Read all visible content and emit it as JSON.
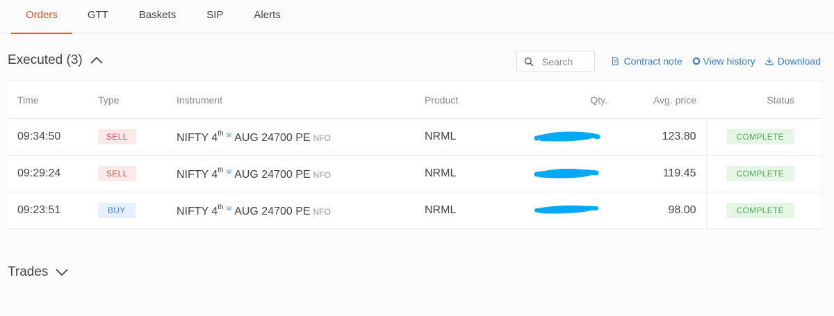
{
  "tabs": [
    {
      "label": "Orders",
      "active": true
    },
    {
      "label": "GTT",
      "active": false
    },
    {
      "label": "Baskets",
      "active": false
    },
    {
      "label": "SIP",
      "active": false
    },
    {
      "label": "Alerts",
      "active": false
    }
  ],
  "executed": {
    "title": "Executed (3)",
    "search_placeholder": "Search",
    "actions": {
      "contract_note": "Contract note",
      "view_history": "View history",
      "download": "Download"
    },
    "columns": {
      "time": "Time",
      "type": "Type",
      "instrument": "Instrument",
      "product": "Product",
      "qty": "Qty.",
      "avg_price": "Avg. price",
      "status": "Status"
    },
    "rows": [
      {
        "time": "09:34:50",
        "type": "SELL",
        "symbol": "NIFTY 4",
        "suffix": "th",
        "weekly": "W",
        "rest": "AUG 24700 PE",
        "exchange": "NFO",
        "product": "NRML",
        "avg_price": "123.80",
        "status": "COMPLETE"
      },
      {
        "time": "09:29:24",
        "type": "SELL",
        "symbol": "NIFTY 4",
        "suffix": "th",
        "weekly": "W",
        "rest": "AUG 24700 PE",
        "exchange": "NFO",
        "product": "NRML",
        "avg_price": "119.45",
        "status": "COMPLETE"
      },
      {
        "time": "09:23:51",
        "type": "BUY",
        "symbol": "NIFTY 4",
        "suffix": "th",
        "weekly": "W",
        "rest": "AUG 24700 PE",
        "exchange": "NFO",
        "product": "NRML",
        "avg_price": "98.00",
        "status": "COMPLETE"
      }
    ]
  },
  "trades": {
    "title": "Trades"
  },
  "colors": {
    "accent": "#e0532f",
    "link": "#387ed1",
    "sell": "#df514c",
    "buy": "#4184f3",
    "complete": "#4caf50",
    "redaction": "#03a9f4"
  }
}
